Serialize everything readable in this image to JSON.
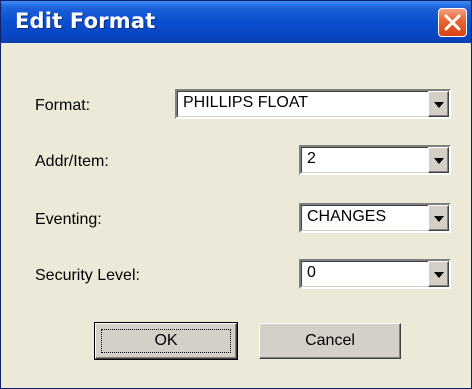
{
  "window": {
    "title": "Edit Format"
  },
  "form": {
    "fields": [
      {
        "label": "Format:",
        "value": "PHILLIPS FLOAT"
      },
      {
        "label": "Addr/Item:",
        "value": "2"
      },
      {
        "label": "Eventing:",
        "value": "CHANGES"
      },
      {
        "label": "Security Level:",
        "value": "0"
      }
    ]
  },
  "buttons": {
    "ok": "OK",
    "cancel": "Cancel"
  },
  "icons": {
    "close": "close-icon",
    "dropdown": "chevron-down-icon"
  },
  "colors": {
    "titlebar": "#0a4fd0",
    "close_button": "#e8683a",
    "dialog_background": "#ece9d8"
  }
}
